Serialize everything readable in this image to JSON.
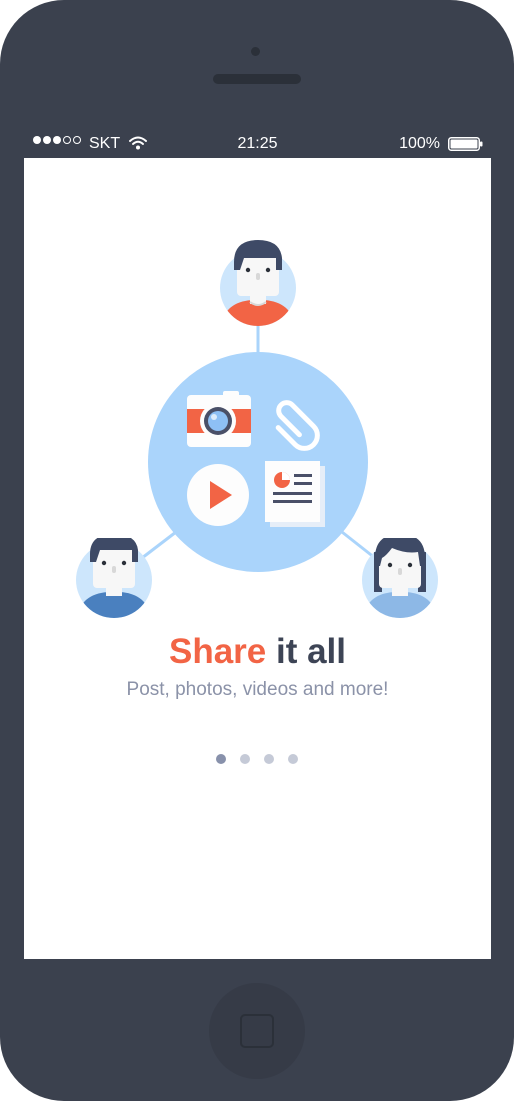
{
  "status_bar": {
    "signal_dots": [
      1,
      1,
      1,
      0,
      0
    ],
    "carrier": "SKT",
    "time": "21:25",
    "battery_percent": "100%",
    "battery_level": 1.0,
    "wifi_icon": "wifi-icon"
  },
  "hero": {
    "title_accent": "Share",
    "title_rest": " it all",
    "subtitle": "Post, photos, videos and more!",
    "icons": [
      "camera-icon",
      "paperclip-icon",
      "play-icon",
      "document-icon"
    ],
    "avatars": [
      "user-avatar-top",
      "user-avatar-left",
      "user-avatar-right"
    ]
  },
  "pager": {
    "total": 4,
    "current": 1
  },
  "colors": {
    "accent": "#f26445",
    "title_dark": "#3d4455",
    "subtitle": "#8b92a8",
    "hub": "#aad4fb",
    "phone_body": "#3b414e"
  }
}
